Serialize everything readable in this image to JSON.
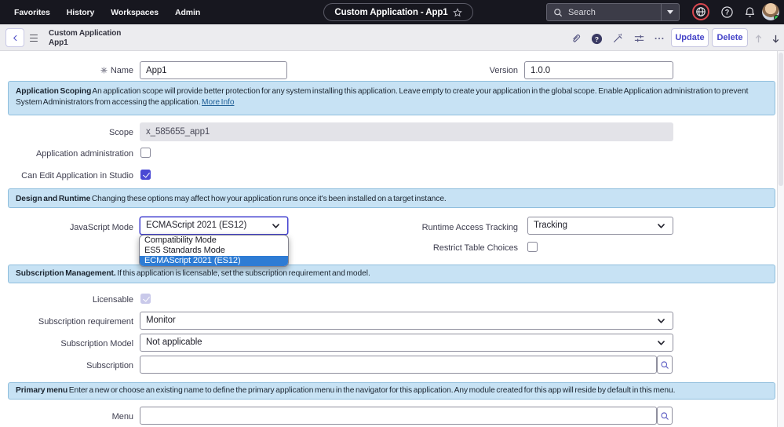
{
  "header": {
    "nav": [
      "Favorites",
      "History",
      "Workspaces",
      "Admin"
    ],
    "app_pill": "Custom Application - App1",
    "search_placeholder": "Search"
  },
  "toolbar": {
    "title_line1": "Custom Application",
    "title_line2": "App1",
    "update_label": "Update",
    "delete_label": "Delete"
  },
  "form": {
    "name": {
      "label": "Name",
      "value": "App1",
      "required": true
    },
    "version": {
      "label": "Version",
      "value": "1.0.0"
    },
    "scoping_note": {
      "bold": "Application Scoping",
      "text": " An application scope will provide better protection for any system installing this application. Leave empty to create your application in the global scope. Enable Application administration to prevent System Administrators from accessing the application. ",
      "link": "More Info"
    },
    "scope": {
      "label": "Scope",
      "value": "x_585655_app1",
      "readonly": true
    },
    "app_admin": {
      "label": "Application administration",
      "checked": false
    },
    "can_edit_studio": {
      "label": "Can Edit Application in Studio",
      "checked": true
    },
    "design_note": {
      "bold": "Design and Runtime",
      "text": " Changing these options may affect how your application runs once it's been installed on a target instance."
    },
    "js_mode": {
      "label": "JavaScript Mode",
      "value": "ECMAScript 2021 (ES12)",
      "options": [
        "Compatibility Mode",
        "ES5 Standards Mode",
        "ECMAScript 2021 (ES12)"
      ],
      "selected_option": "ECMAScript 2021 (ES12)"
    },
    "runtime_tracking": {
      "label": "Runtime Access Tracking",
      "value": "Tracking"
    },
    "restrict_tables": {
      "label": "Restrict Table Choices",
      "checked": false
    },
    "subscription_note": {
      "bold": "Subscription Management.",
      "text": " If this application is licensable, set the subscription requirement and model."
    },
    "licensable": {
      "label": "Licensable",
      "checked": true,
      "disabled": true
    },
    "sub_requirement": {
      "label": "Subscription requirement",
      "value": "Monitor"
    },
    "sub_model": {
      "label": "Subscription Model",
      "value": "Not applicable"
    },
    "subscription": {
      "label": "Subscription",
      "value": ""
    },
    "menu_note": {
      "bold": "Primary menu",
      "text": " Enter a new or choose an existing name to define the primary application menu in the navigator for this application. Any module created for this app will reside by default in this menu."
    },
    "menu": {
      "label": "Menu",
      "value": ""
    }
  },
  "colors": {
    "header_bg": "#17171f",
    "accent": "#4544d8",
    "band_bg": "#c7e2f4",
    "band_border": "#8fbedd",
    "option_highlight": "#2e7cd4",
    "checkbox_checked": "#4a49d4",
    "globe_alert_ring": "#d8474f",
    "presence_green": "#35c24f"
  }
}
